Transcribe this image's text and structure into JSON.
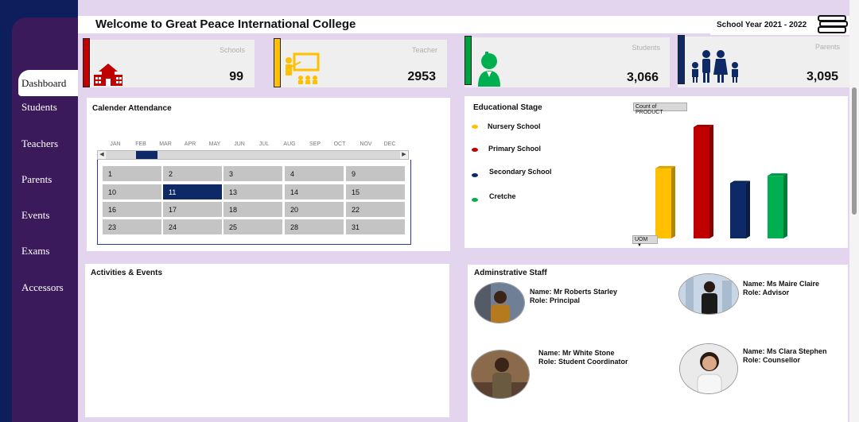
{
  "header": {
    "title": "Welcome to Great Peace International College",
    "school_year": "School Year 2021 - 2022"
  },
  "sidebar": {
    "items": [
      {
        "label": "Dashboard"
      },
      {
        "label": "Students"
      },
      {
        "label": "Teachers"
      },
      {
        "label": "Parents"
      },
      {
        "label": "Events"
      },
      {
        "label": "Exams"
      },
      {
        "label": "Accessors"
      }
    ]
  },
  "kpis": [
    {
      "label": "Schools",
      "value": "99",
      "color": "#c00000"
    },
    {
      "label": "Teacher",
      "value": "2953",
      "color": "#ffc000"
    },
    {
      "label": "Students",
      "value": "3,066",
      "color": "#00a040"
    },
    {
      "label": "Parents",
      "value": "3,095",
      "color": "#0e2a66"
    }
  ],
  "calendar": {
    "title": "Calender Attendance",
    "months": [
      "JAN",
      "FEB",
      "MAR",
      "APR",
      "MAY",
      "JUN",
      "JUL",
      "AUG",
      "SEP",
      "OCT",
      "NOV",
      "DEC"
    ],
    "days": [
      "1",
      "2",
      "3",
      "4",
      "9",
      "10",
      "11",
      "13",
      "14",
      "15",
      "16",
      "17",
      "18",
      "20",
      "22",
      "23",
      "24",
      "25",
      "28",
      "31"
    ],
    "selected_day": "11"
  },
  "stage": {
    "title": "Educational  Stage",
    "count_label": "Count of PRODUCT",
    "uom_label": "UOM",
    "legend": [
      {
        "label": "Nursery School",
        "color": "#ffc000"
      },
      {
        "label": "Primary School",
        "color": "#c00000"
      },
      {
        "label": "Secondary School",
        "color": "#0e2a66"
      },
      {
        "label": "Cretche",
        "color": "#00b050"
      }
    ]
  },
  "chart_data": {
    "type": "bar",
    "categories": [
      "Nursery School",
      "Primary School",
      "Secondary School",
      "Cretche"
    ],
    "values": [
      85,
      135,
      67,
      76
    ],
    "colors": [
      "#ffc000",
      "#c00000",
      "#0e2a66",
      "#00b050"
    ],
    "title": "",
    "xlabel": "",
    "ylabel": ""
  },
  "activities": {
    "title": "Activities & Events"
  },
  "staff": {
    "title": "Adminstrative Staff",
    "members": [
      {
        "name": "Name: Mr Roberts Starley",
        "role": "Role: Principal"
      },
      {
        "name": "Name: Ms Maire Claire",
        "role": "Role: Advisor"
      },
      {
        "name": "Name: Mr White Stone",
        "role": "Role: Student Coordinator"
      },
      {
        "name": "Name: Ms Clara Stephen",
        "role": "Role: Counsellor"
      }
    ]
  }
}
